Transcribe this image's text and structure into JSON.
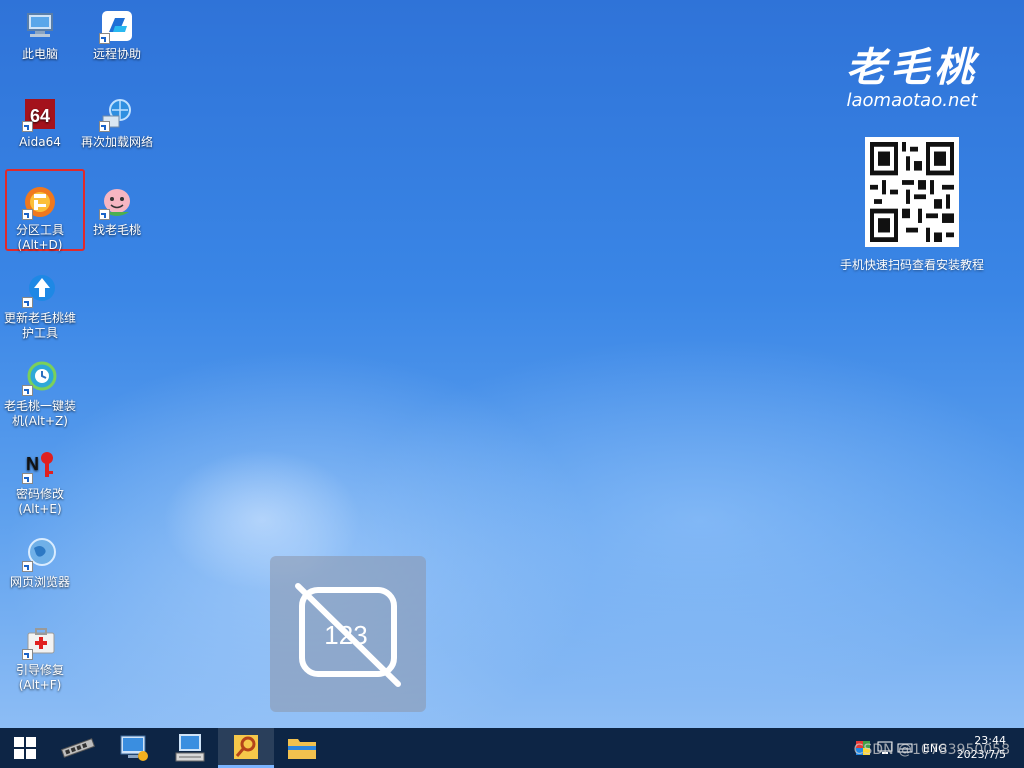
{
  "desktop": {
    "icons": [
      {
        "label": "此电脑",
        "icon": "computer-icon"
      },
      {
        "label": "远程协助",
        "icon": "remote-assist-icon"
      },
      {
        "label": "Aida64",
        "icon": "aida64-icon"
      },
      {
        "label": "再次加载网络",
        "icon": "network-reload-icon"
      },
      {
        "label": "分区工具\n(Alt+D)",
        "icon": "partition-tool-icon"
      },
      {
        "label": "找老毛桃",
        "icon": "peach-mascot-icon"
      },
      {
        "label": "更新老毛桃维\n护工具",
        "icon": "update-tool-icon"
      },
      {
        "label": "老毛桃一键装\n机(Alt+Z)",
        "icon": "one-click-install-icon"
      },
      {
        "label": "密码修改\n(Alt+E)",
        "icon": "password-change-icon"
      },
      {
        "label": "网页浏览器",
        "icon": "web-browser-icon"
      },
      {
        "label": "引导修复\n(Alt+F)",
        "icon": "boot-repair-icon"
      }
    ]
  },
  "brand": {
    "logo": "老毛桃",
    "domain": "laomaotao.net",
    "qr_caption": "手机快速扫码查看安装教程"
  },
  "osd": {
    "digits": "123"
  },
  "taskbar": {
    "apps": [
      {
        "icon": "start-windows-icon"
      },
      {
        "icon": "memory-chip-icon"
      },
      {
        "icon": "computer-management-icon"
      },
      {
        "icon": "keyboard-monitor-icon"
      },
      {
        "icon": "search-tool-icon"
      },
      {
        "icon": "file-explorer-icon"
      }
    ],
    "language": "ENG",
    "time": "23:44",
    "date": "2023/7/5"
  },
  "watermark": "CSDN @10783950058",
  "colors": {
    "selection_border": "#e12a2a",
    "taskbar_bg": "#0d2545",
    "desktop_blue": "#3a86e6"
  }
}
